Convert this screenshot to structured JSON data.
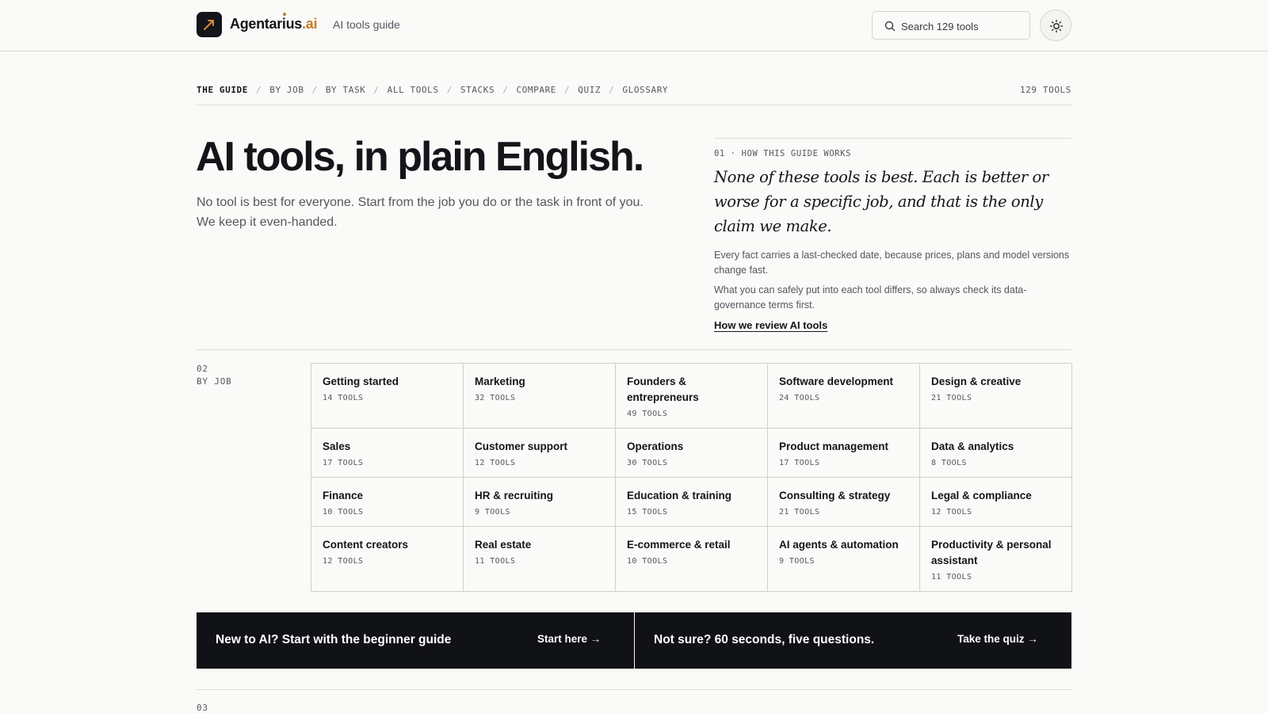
{
  "header": {
    "brand_name": "Agentarius",
    "brand_suffix": ".ai",
    "brand_subtitle": "AI tools guide",
    "search_placeholder": "Search 129 tools",
    "accent_color": "#c9792b"
  },
  "nav": {
    "items": [
      {
        "label": "THE GUIDE",
        "active": true
      },
      {
        "label": "BY JOB"
      },
      {
        "label": "BY TASK"
      },
      {
        "label": "ALL TOOLS"
      },
      {
        "label": "STACKS"
      },
      {
        "label": "COMPARE"
      },
      {
        "label": "QUIZ"
      },
      {
        "label": "GLOSSARY"
      }
    ],
    "separator": "/",
    "tool_count": "129 TOOLS"
  },
  "hero": {
    "title": "AI tools, in plain English.",
    "subtitle": "No tool is best for everyone. Start from the job you do or the task in front of you. We keep it even-handed."
  },
  "how": {
    "label": "01 · HOW THIS GUIDE WORKS",
    "quote": "None of these tools is best. Each is better or worse for a specific job, and that is the only claim we make.",
    "p1": "Every fact carries a last-checked date, because prices, plans and model versions change fast.",
    "p2": "What you can safely put into each tool differs, so always check its data-governance terms first.",
    "link": "How we review AI tools"
  },
  "by_job": {
    "number": "02",
    "label": "BY JOB",
    "jobs": [
      {
        "name": "Getting started",
        "count": "14 TOOLS"
      },
      {
        "name": "Marketing",
        "count": "32 TOOLS"
      },
      {
        "name": "Founders & entrepreneurs",
        "count": "49 TOOLS"
      },
      {
        "name": "Software development",
        "count": "24 TOOLS"
      },
      {
        "name": "Design & creative",
        "count": "21 TOOLS"
      },
      {
        "name": "Sales",
        "count": "17 TOOLS"
      },
      {
        "name": "Customer support",
        "count": "12 TOOLS"
      },
      {
        "name": "Operations",
        "count": "30 TOOLS"
      },
      {
        "name": "Product management",
        "count": "17 TOOLS"
      },
      {
        "name": "Data & analytics",
        "count": "8 TOOLS"
      },
      {
        "name": "Finance",
        "count": "10 TOOLS"
      },
      {
        "name": "HR & recruiting",
        "count": "9 TOOLS"
      },
      {
        "name": "Education & training",
        "count": "15 TOOLS"
      },
      {
        "name": "Consulting & strategy",
        "count": "21 TOOLS"
      },
      {
        "name": "Legal & compliance",
        "count": "12 TOOLS"
      },
      {
        "name": "Content creators",
        "count": "12 TOOLS"
      },
      {
        "name": "Real estate",
        "count": "11 TOOLS"
      },
      {
        "name": "E-commerce & retail",
        "count": "10 TOOLS"
      },
      {
        "name": "AI agents & automation",
        "count": "9 TOOLS"
      },
      {
        "name": "Productivity & personal assistant",
        "count": "11 TOOLS"
      }
    ]
  },
  "cta": {
    "beginner_text": "New to AI? Start with the beginner guide",
    "beginner_link": "Start here →",
    "quiz_text": "Not sure? 60 seconds, five questions.",
    "quiz_link": "Take the quiz →"
  },
  "next_section": {
    "number": "03"
  }
}
